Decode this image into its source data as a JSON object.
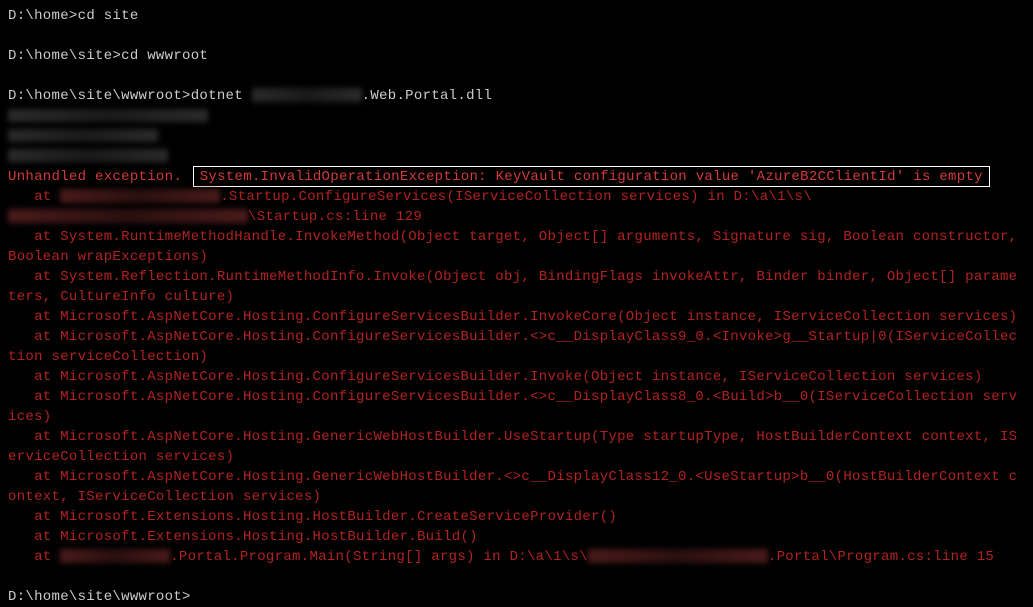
{
  "prompts": {
    "p1": "D:\\home>",
    "p1_cmd": "cd site",
    "p2": "D:\\home\\site>",
    "p2_cmd": "cd wwwroot",
    "p3": "D:\\home\\site\\wwwroot>",
    "p3_cmd_pre": "dotnet ",
    "p3_cmd_post": ".Web.Portal.dll",
    "p4": "D:\\home\\site\\wwwroot>"
  },
  "error": {
    "unhandled": "Unhandled exception.",
    "exception_msg": "System.InvalidOperationException: KeyVault configuration value 'AzureB2CClientId' is empty",
    "st1_at": "   at ",
    "st1_mid": ".Startup.ConfigureServices(IServiceCollection services) in D:\\a\\1\\s\\",
    "st1_end": "\\Startup.cs:line 129",
    "st2": "   at System.RuntimeMethodHandle.InvokeMethod(Object target, Object[] arguments, Signature sig, Boolean constructor, Boolean wrapExceptions)",
    "st3": "   at System.Reflection.RuntimeMethodInfo.Invoke(Object obj, BindingFlags invokeAttr, Binder binder, Object[] parameters, CultureInfo culture)",
    "st4": "   at Microsoft.AspNetCore.Hosting.ConfigureServicesBuilder.InvokeCore(Object instance, IServiceCollection services)",
    "st5": "   at Microsoft.AspNetCore.Hosting.ConfigureServicesBuilder.<>c__DisplayClass9_0.<Invoke>g__Startup|0(IServiceCollection serviceCollection)",
    "st6": "   at Microsoft.AspNetCore.Hosting.ConfigureServicesBuilder.Invoke(Object instance, IServiceCollection services)",
    "st7": "   at Microsoft.AspNetCore.Hosting.ConfigureServicesBuilder.<>c__DisplayClass8_0.<Build>b__0(IServiceCollection services)",
    "st8": "   at Microsoft.AspNetCore.Hosting.GenericWebHostBuilder.UseStartup(Type startupType, HostBuilderContext context, IServiceCollection services)",
    "st9": "   at Microsoft.AspNetCore.Hosting.GenericWebHostBuilder.<>c__DisplayClass12_0.<UseStartup>b__0(HostBuilderContext context, IServiceCollection services)",
    "st10": "   at Microsoft.Extensions.Hosting.HostBuilder.CreateServiceProvider()",
    "st11": "   at Microsoft.Extensions.Hosting.HostBuilder.Build()",
    "st12_at": "   at ",
    "st12_mid": ".Portal.Program.Main(String[] args) in D:\\a\\1\\s\\",
    "st12_end": ".Portal\\Program.cs:line 15"
  }
}
